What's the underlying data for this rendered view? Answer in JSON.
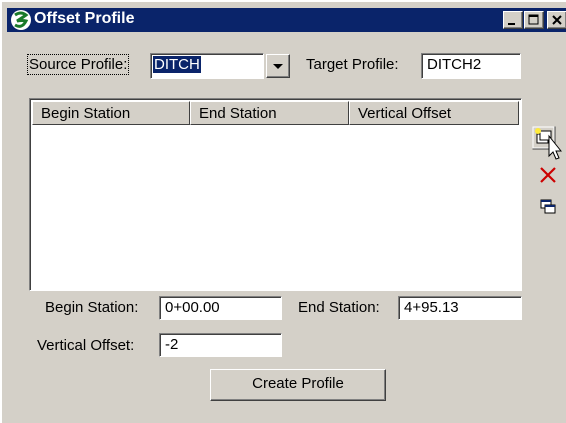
{
  "window": {
    "title": "Offset Profile"
  },
  "source": {
    "label": "Source Profile:",
    "value": "DITCH"
  },
  "target": {
    "label": "Target Profile:",
    "value": "DITCH2"
  },
  "table": {
    "columns": [
      "Begin Station",
      "End Station",
      "Vertical Offset"
    ],
    "rows": []
  },
  "fields": {
    "begin_station": {
      "label": "Begin Station:",
      "value": "0+00.00"
    },
    "end_station": {
      "label": "End Station:",
      "value": "4+95.13"
    },
    "vertical_offset": {
      "label": "Vertical Offset:",
      "value": "-2"
    }
  },
  "buttons": {
    "create": "Create Profile"
  },
  "icons": {
    "app": "geopak-app-icon",
    "add": "add-row-icon",
    "delete": "delete-x-icon",
    "copy": "copy-windows-icon"
  },
  "colors": {
    "titlebar": "#0a246a",
    "face": "#d4d0c8",
    "delete": "#cc0000"
  }
}
